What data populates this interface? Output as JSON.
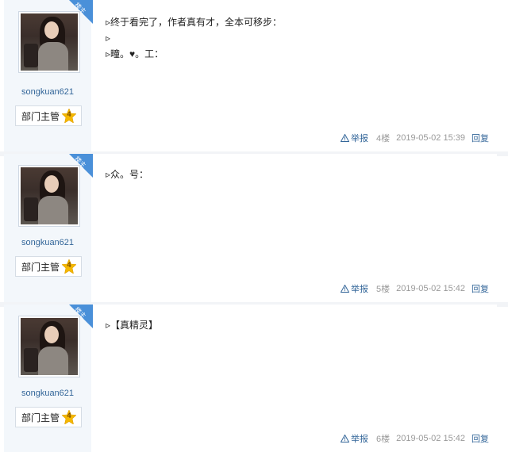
{
  "posts": [
    {
      "username": "songkuan621",
      "rank_title": "部门主管",
      "rank_level": "4",
      "badge": "楼主",
      "lines": [
        "▹终于看完了，作者真有才，全本可移步：",
        "▹",
        "▹疃。♥。工："
      ],
      "actions": {
        "report": "举报",
        "floor": "4楼",
        "time": "2019-05-02 15:39",
        "reply": "回复"
      }
    },
    {
      "username": "songkuan621",
      "rank_title": "部门主管",
      "rank_level": "4",
      "badge": "楼主",
      "lines": [
        "▹众。号："
      ],
      "actions": {
        "report": "举报",
        "floor": "5楼",
        "time": "2019-05-02 15:42",
        "reply": "回复"
      }
    },
    {
      "username": "songkuan621",
      "rank_title": "部门主管",
      "rank_level": "4",
      "badge": "楼主",
      "lines": [
        "▹【真精灵】"
      ],
      "actions": {
        "report": "举报",
        "floor": "6楼",
        "time": "2019-05-02 15:42",
        "reply": "回复"
      }
    }
  ],
  "icons": {
    "report": "warning-triangle-icon",
    "rank": "star-badge-icon"
  },
  "colors": {
    "link": "#336699",
    "sidebar": "#f3f7fb",
    "badge": "#4a90d9",
    "star": "#f5b800"
  }
}
